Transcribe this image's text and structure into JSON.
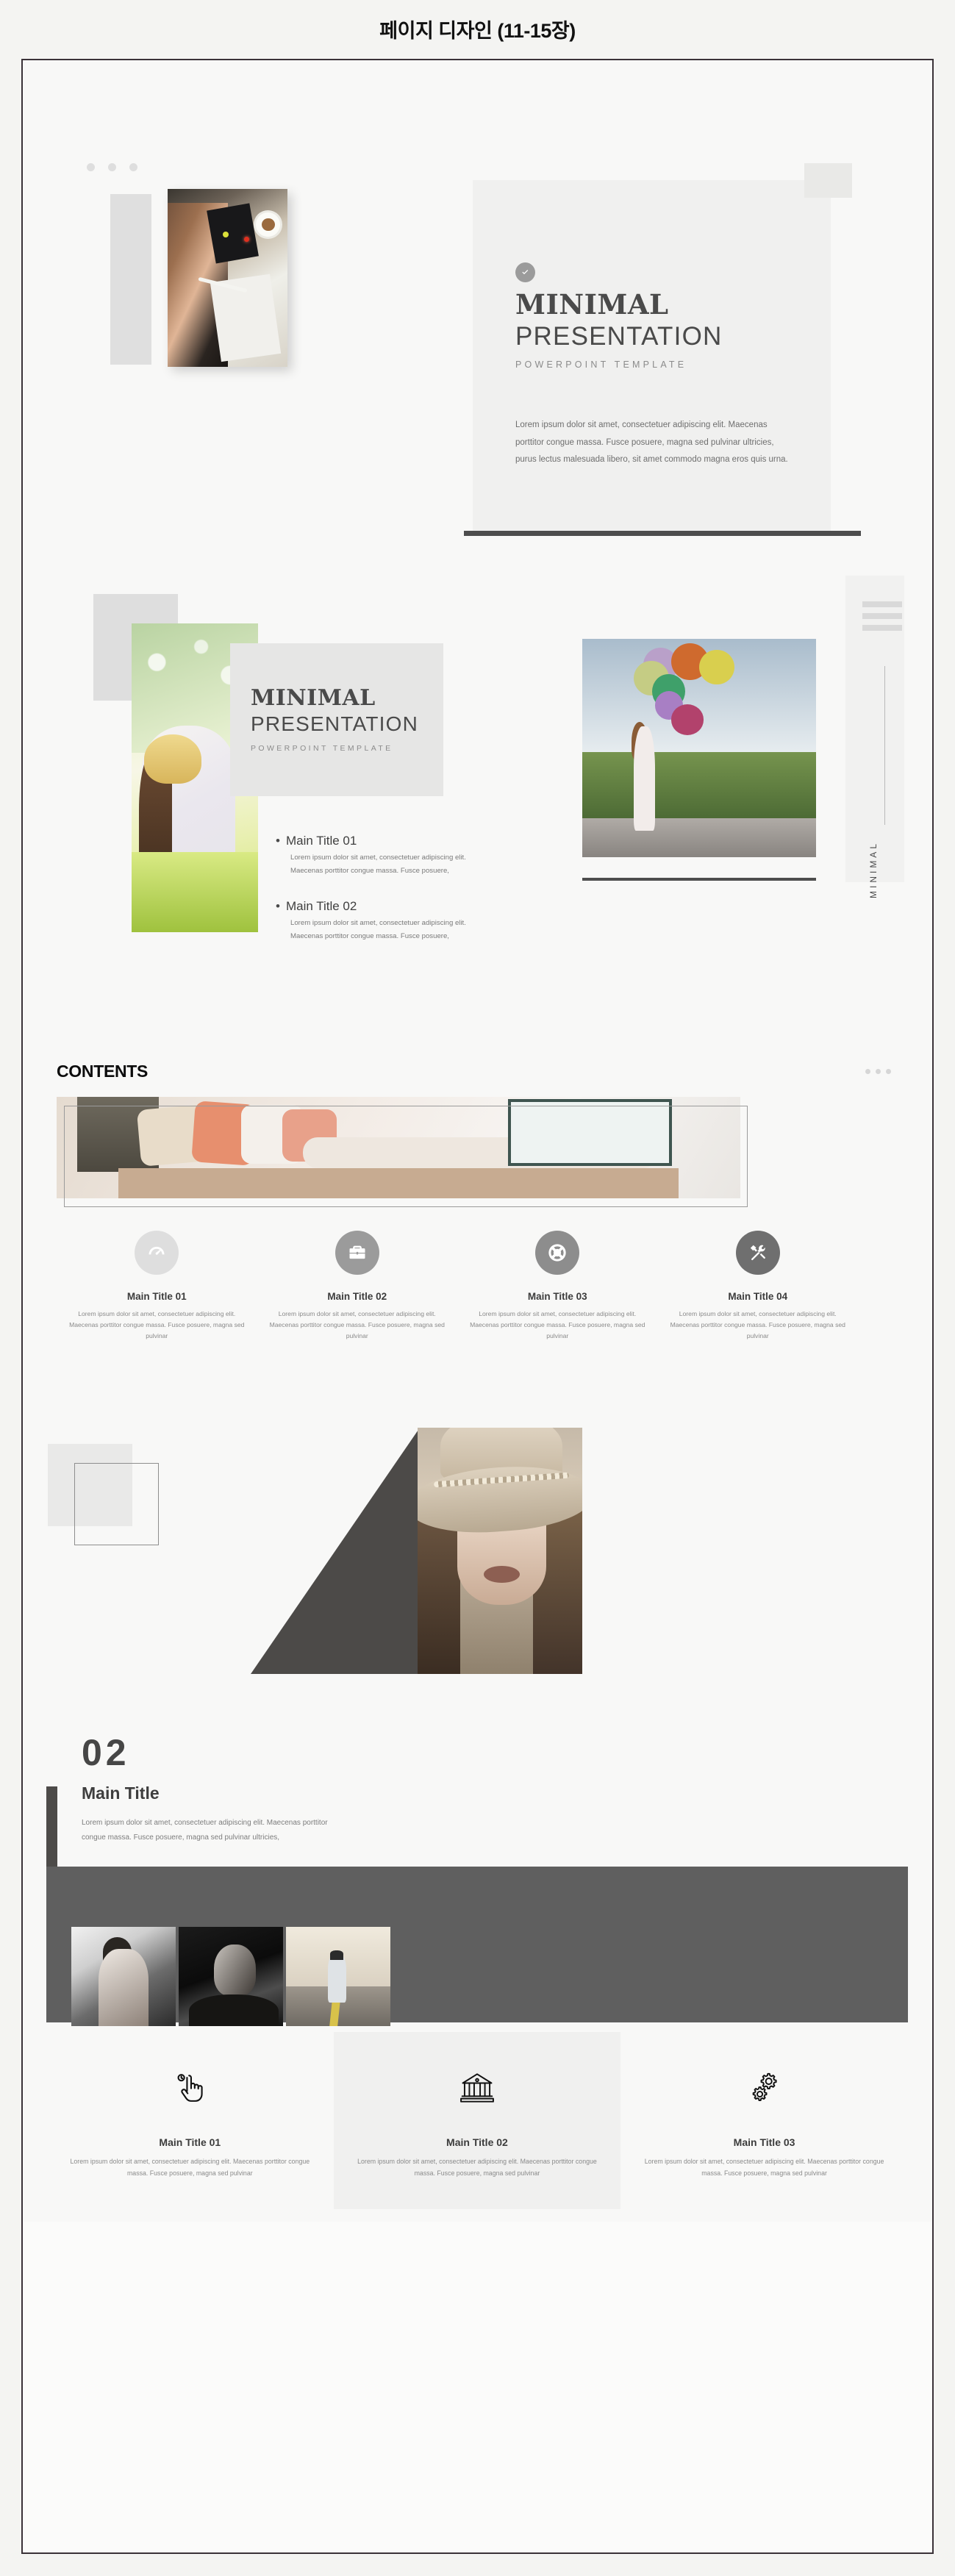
{
  "header": {
    "title": "페이지 디자인 (11-15장)"
  },
  "colors": {
    "page_bg": "#f4f4f2",
    "frame_border": "#3a3238",
    "slide_bg": "#f8f8f7",
    "panel_gray": "#f0f0ef",
    "accent_dark": "#4d4d4d",
    "band_gray": "#5f5f5f",
    "icon_circle_light": "#dedede",
    "icon_circle_mid": "#9b9b9b",
    "icon_circle_dark": "#7a7a7a",
    "text_dark": "#3c3c3c",
    "text_muted": "#8a8a8a"
  },
  "slide1": {
    "icon_check": "check-circle-icon",
    "title_main": "MINIMAL",
    "title_second": "PRESENTATION",
    "subtitle": "POWERPOINT TEMPLATE",
    "body": "Lorem ipsum dolor sit amet, consectetuer adipiscing elit. Maecenas porttitor congue massa. Fusce posuere, magna sed pulvinar ultricies, purus lectus malesuada libero, sit amet commodo magna eros quis urna.",
    "photo_alt": "woman-writing-at-desk-photo"
  },
  "slide2": {
    "title_main": "MINIMAL",
    "title_second": "PRESENTATION",
    "subtitle": "POWERPOINT TEMPLATE",
    "vertical_label": "MINIMAL",
    "bullets": [
      {
        "title": "Main Title 01",
        "body": "Lorem ipsum dolor sit amet, consectetuer adipiscing elit. Maecenas porttitor congue massa. Fusce posuere,"
      },
      {
        "title": "Main Title 02",
        "body": "Lorem ipsum dolor sit amet, consectetuer adipiscing elit. Maecenas porttitor congue massa. Fusce posuere,"
      }
    ],
    "photo_left_alt": "woman-in-field-with-hat-photo",
    "photo_right_alt": "girl-with-balloons-photo"
  },
  "slide3": {
    "heading": "CONTENTS",
    "photo_alt": "bedroom-interior-photo",
    "cards": [
      {
        "icon": "speedometer-icon",
        "circle_color": "#dedede",
        "title": "Main Title 01",
        "body": "Lorem ipsum dolor sit amet, consectetuer adipiscing elit. Maecenas porttitor congue massa. Fusce posuere, magna sed pulvinar"
      },
      {
        "icon": "briefcase-icon",
        "circle_color": "#9b9b9b",
        "title": "Main Title 02",
        "body": "Lorem ipsum dolor sit amet, consectetuer adipiscing elit. Maecenas porttitor congue massa. Fusce posuere, magna sed pulvinar"
      },
      {
        "icon": "lifebuoy-icon",
        "circle_color": "#8d8d8d",
        "title": "Main Title 03",
        "body": "Lorem ipsum dolor sit amet, consectetuer adipiscing elit. Maecenas porttitor congue massa. Fusce posuere, magna sed pulvinar"
      },
      {
        "icon": "hammer-wrench-icon",
        "circle_color": "#6f6f6f",
        "title": "Main Title 04",
        "body": "Lorem ipsum dolor sit amet, consectetuer adipiscing elit. Maecenas porttitor congue massa. Fusce posuere, magna sed pulvinar"
      }
    ]
  },
  "slide4": {
    "number": "02",
    "title": "Main Title",
    "body": "Lorem ipsum dolor sit amet, consectetuer adipiscing elit. Maecenas porttitor congue massa. Fusce posuere, magna sed pulvinar ultricies,",
    "photo_alt": "woman-with-hat-portrait-photo",
    "thumbs": [
      {
        "alt": "seated-woman-bw-photo"
      },
      {
        "alt": "man-profile-dark-photo"
      },
      {
        "alt": "man-jumping-street-photo"
      }
    ],
    "cards": [
      {
        "icon": "hand-click-clock-icon",
        "title": "Main Title 01",
        "body": "Lorem ipsum dolor sit amet, consectetuer adipiscing elit. Maecenas porttitor congue massa. Fusce posuere, magna sed pulvinar"
      },
      {
        "icon": "bank-building-icon",
        "title": "Main Title 02",
        "body": "Lorem ipsum dolor sit amet, consectetuer adipiscing elit. Maecenas porttitor congue massa. Fusce posuere, magna sed pulvinar"
      },
      {
        "icon": "gears-icon",
        "title": "Main Title 03",
        "body": "Lorem ipsum dolor sit amet, consectetuer adipiscing elit. Maecenas porttitor congue massa. Fusce posuere, magna sed pulvinar"
      }
    ]
  }
}
